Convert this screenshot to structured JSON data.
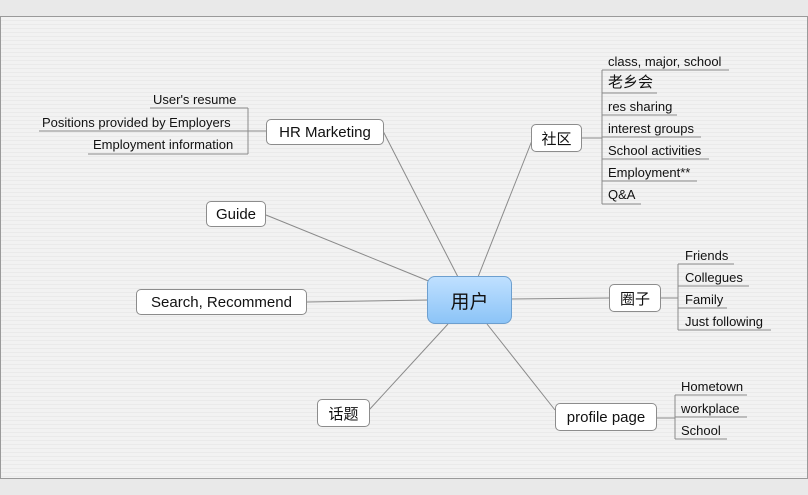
{
  "center": {
    "label": "用户"
  },
  "branches": {
    "hr_marketing": {
      "label": "HR Marketing",
      "children": [
        "User's resume",
        "Positions provided by Employers",
        "Employment information"
      ]
    },
    "guide": {
      "label": "Guide"
    },
    "search": {
      "label": "Search, Recommend"
    },
    "topics": {
      "label": "话题"
    },
    "community": {
      "label": "社区",
      "children": [
        "class, major, school",
        "老乡会",
        "res sharing",
        "interest groups",
        "School activities",
        "Employment**",
        "Q&A"
      ]
    },
    "circle": {
      "label": "圈子",
      "children": [
        "Friends",
        "Collegues",
        "Family",
        "Just following"
      ]
    },
    "profile": {
      "label": "profile page",
      "children": [
        "Hometown",
        "workplace",
        "School"
      ]
    }
  },
  "colors": {
    "center_fill_top": "#bfe0ff",
    "center_fill_bottom": "#8cc4f7",
    "center_border": "#6d9fcf",
    "node_border": "#8c8c8c",
    "connector": "#8a8a8a",
    "canvas": "#f2f2f2"
  }
}
